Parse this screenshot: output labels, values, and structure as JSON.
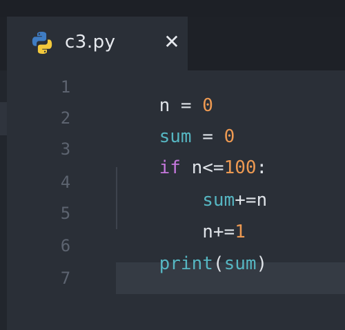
{
  "tab": {
    "title": "c3.py",
    "close_glyph": "✕",
    "icon": "python-icon"
  },
  "editor": {
    "lines": [
      {
        "number": "1",
        "tokens": [
          {
            "text": "n",
            "kind": "var"
          },
          {
            "text": " = ",
            "kind": "op"
          },
          {
            "text": "0",
            "kind": "num"
          }
        ]
      },
      {
        "number": "2",
        "tokens": [
          {
            "text": "sum",
            "kind": "fn"
          },
          {
            "text": " = ",
            "kind": "op"
          },
          {
            "text": "0",
            "kind": "num"
          }
        ]
      },
      {
        "number": "3",
        "tokens": [
          {
            "text": "if",
            "kind": "kw"
          },
          {
            "text": " n<=",
            "kind": "op"
          },
          {
            "text": "100",
            "kind": "num"
          },
          {
            "text": ":",
            "kind": "op"
          }
        ]
      },
      {
        "number": "4",
        "tokens": [
          {
            "text": "    ",
            "kind": "op"
          },
          {
            "text": "sum",
            "kind": "fn"
          },
          {
            "text": "+=n",
            "kind": "op"
          }
        ]
      },
      {
        "number": "5",
        "tokens": [
          {
            "text": "    n+=",
            "kind": "op"
          },
          {
            "text": "1",
            "kind": "num"
          }
        ]
      },
      {
        "number": "6",
        "tokens": [
          {
            "text": "print",
            "kind": "fn"
          },
          {
            "text": "(",
            "kind": "op"
          },
          {
            "text": "sum",
            "kind": "fn"
          },
          {
            "text": ")",
            "kind": "op"
          }
        ]
      },
      {
        "number": "7",
        "tokens": []
      }
    ]
  },
  "colors": {
    "background": "#2a2f37",
    "keyword": "#c678dd",
    "function": "#56b6c2",
    "number": "#ee9a52",
    "text": "#dfe3e8",
    "line_number": "#5d6470"
  }
}
